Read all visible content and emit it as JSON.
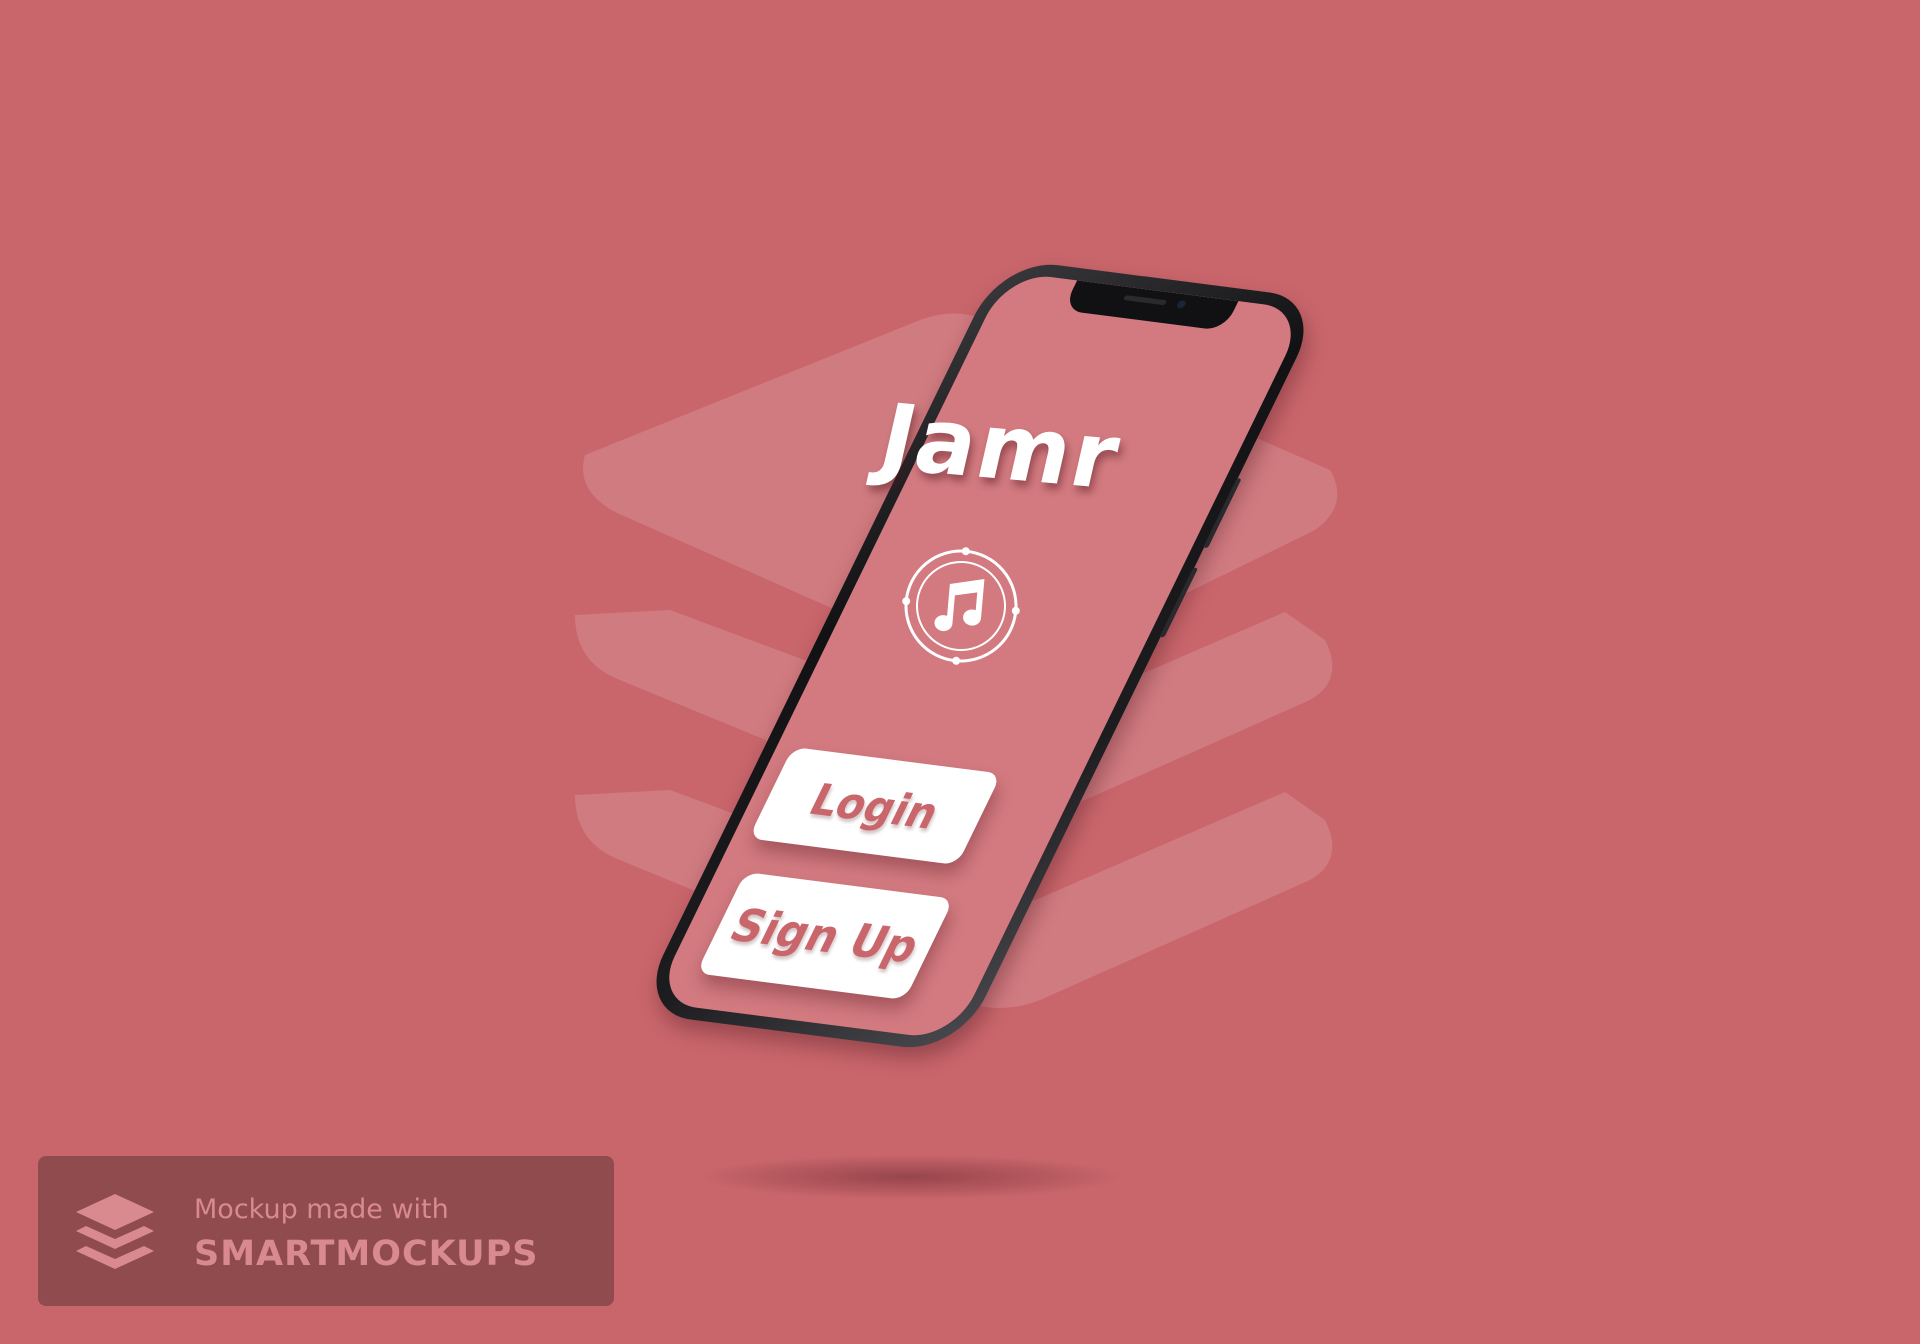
{
  "background_color": "#C9666C",
  "app": {
    "title": "Jamr",
    "icon": "music-note-circle-icon",
    "buttons": {
      "login_label": "Login",
      "signup_label": "Sign Up"
    },
    "accent_color": "#C9666C",
    "screen_color": "#D27A80"
  },
  "watermark": {
    "line1": "Mockup made with",
    "line2": "SMARTMOCKUPS",
    "icon": "layers-icon",
    "badge_color": "#904B4E",
    "text_color": "#D98A8F"
  }
}
